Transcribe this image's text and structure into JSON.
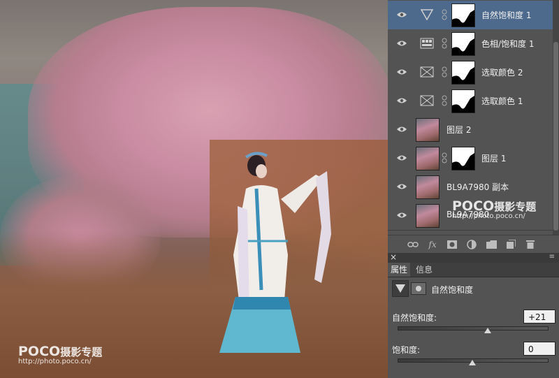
{
  "photo": {
    "watermark_bottom_logo": "POCO",
    "watermark_bottom_title": "摄影专题",
    "watermark_bottom_url": "http://photo.poco.cn/"
  },
  "layers": {
    "items": [
      {
        "name": "自然饱和度 1",
        "kind": "adjustment",
        "icon": "vibrance-triangle-icon",
        "mask": true,
        "active": true
      },
      {
        "name": "色相/饱和度 1",
        "kind": "adjustment",
        "icon": "hue-saturation-icon",
        "mask": true,
        "active": false
      },
      {
        "name": "选取颜色 2",
        "kind": "adjustment",
        "icon": "selective-color-icon",
        "mask": true,
        "active": false
      },
      {
        "name": "选取颜色 1",
        "kind": "adjustment",
        "icon": "selective-color-icon",
        "mask": true,
        "active": false
      },
      {
        "name": "图层 2",
        "kind": "pixel",
        "mask": false,
        "active": false
      },
      {
        "name": "图层 1",
        "kind": "pixel",
        "mask": true,
        "active": false
      },
      {
        "name": "BL9A7980 副本",
        "kind": "pixel",
        "mask": false,
        "active": false
      },
      {
        "name": "BL9A7980",
        "kind": "pixel",
        "mask": false,
        "active": false
      }
    ],
    "panel_watermark_logo": "POCO",
    "panel_watermark_title": "摄影专题",
    "panel_watermark_url": "http://photo.poco.cn/",
    "toolbar_icons": [
      "link-layers-icon",
      "fx-icon",
      "add-mask-icon",
      "adjustment-layer-icon",
      "new-group-icon",
      "new-layer-icon",
      "delete-layer-icon"
    ],
    "fx_label": "fx"
  },
  "properties": {
    "tabs": [
      {
        "label": "属性",
        "active": true
      },
      {
        "label": "信息",
        "active": false
      }
    ],
    "adjustment_title": "自然饱和度",
    "vibrance_label": "自然饱和度:",
    "vibrance_value": "+21",
    "vibrance_level": 21,
    "saturation_label": "饱和度:",
    "saturation_value": "0",
    "saturation_level": 0,
    "range": [
      -100,
      100
    ]
  },
  "colors": {
    "active_layer": "#4d6a8c",
    "panel_bg": "#535353"
  }
}
